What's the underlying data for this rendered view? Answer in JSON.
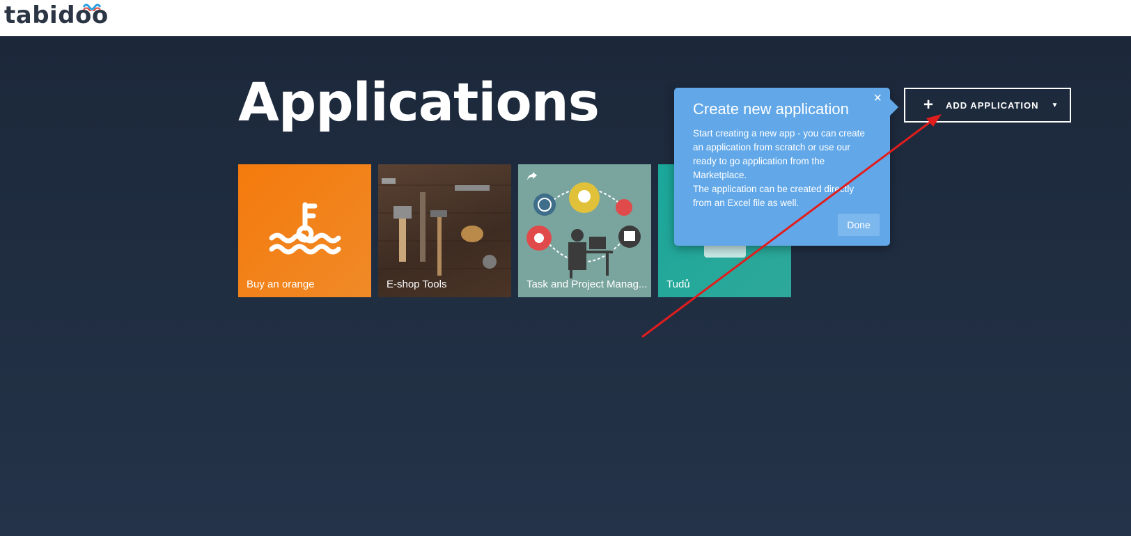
{
  "header": {
    "logo_text": "tabidoo"
  },
  "main": {
    "title": "Applications",
    "add_button": {
      "label": "ADD APPLICATION",
      "plus": "+",
      "caret": "▼"
    }
  },
  "apps": [
    {
      "label": "Buy an orange",
      "color": "#f47a0c",
      "icon": "key-waves-icon"
    },
    {
      "label": "E-shop Tools",
      "icon": "tools-photo"
    },
    {
      "label": "Task and Project Manag...",
      "icon": "task-illustration",
      "shared_icon": "share-icon"
    },
    {
      "label": "Tudů",
      "color": "#1aa79a"
    }
  ],
  "popover": {
    "title": "Create new application",
    "body_lines": [
      "Start creating a new app - you can create",
      "an application from scratch or use our",
      "ready to go application from the",
      "Marketplace.",
      "The application can be created directly",
      "from an Excel file as well."
    ],
    "done_label": "Done",
    "close_glyph": "×",
    "background_color": "#62a8e8"
  },
  "annotation": {
    "arrow_color": "#e11d1d"
  }
}
